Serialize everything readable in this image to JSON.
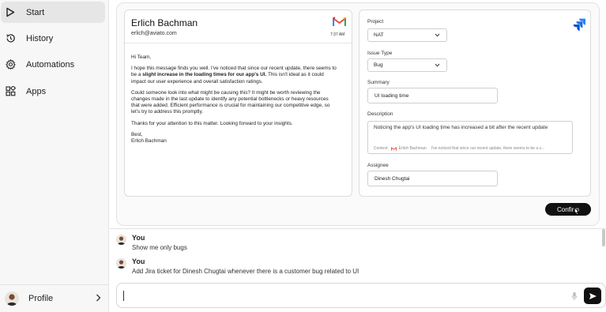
{
  "sidebar": {
    "items": [
      {
        "label": "Start",
        "icon": "play-icon"
      },
      {
        "label": "History",
        "icon": "history-icon"
      },
      {
        "label": "Automations",
        "icon": "gear-icon"
      },
      {
        "label": "Apps",
        "icon": "apps-grid-icon"
      }
    ],
    "profile_label": "Profile"
  },
  "email": {
    "sender": "Erlich Bachman",
    "address": "erlich@aviato.com",
    "time": "7:37 AM",
    "greeting": "Hi Team,",
    "p1_before": "I hope this message finds you well. I've noticed that since our recent update, there seems to be a ",
    "p1_bold": "slight increase in the loading times for our app's UI.",
    "p1_after": " This isn't ideal as it could impact our user experience and overall satisfaction ratings.",
    "p2": "Could someone look into what might be causing this? It might be worth reviewing the changes made in the last update to identify any potential bottlenecks or heavy resources that were added. Efficient performance is crucial for maintaining our competitive edge, so let's try to address this promptly.",
    "p3": "Thanks for your attention to this matter. Looking forward to your insights.",
    "closing": "Best,",
    "signature": "Erlich Bachman"
  },
  "jira": {
    "project_label": "Project",
    "project_value": "NAT",
    "issue_type_label": "Issue Type",
    "issue_type_value": "Bug",
    "summary_label": "Summary",
    "summary_value": "UI loading time",
    "description_label": "Description",
    "description_value": "Noticing the app's UI loading time has increased a bit after the recent update",
    "context_label": "Context:",
    "context_sender": "Erlich Bachman",
    "context_snippet": "I've noticed that since our recent update, there seems to be a s...",
    "assignee_label": "Assignee",
    "assignee_value": "Dinesh Chugtai"
  },
  "confirm_label": "Confirm",
  "chat": {
    "messages": [
      {
        "author": "You",
        "text": "Show me only bugs"
      },
      {
        "author": "You",
        "text": "Add Jira ticket for Dinesh Chugtai whenever there is a customer bug related to UI"
      }
    ],
    "input_value": "",
    "input_placeholder": ""
  },
  "colors": {
    "accent_dark": "#111111",
    "jira_blue": "#2684FF",
    "gmail_red": "#EA4335"
  }
}
